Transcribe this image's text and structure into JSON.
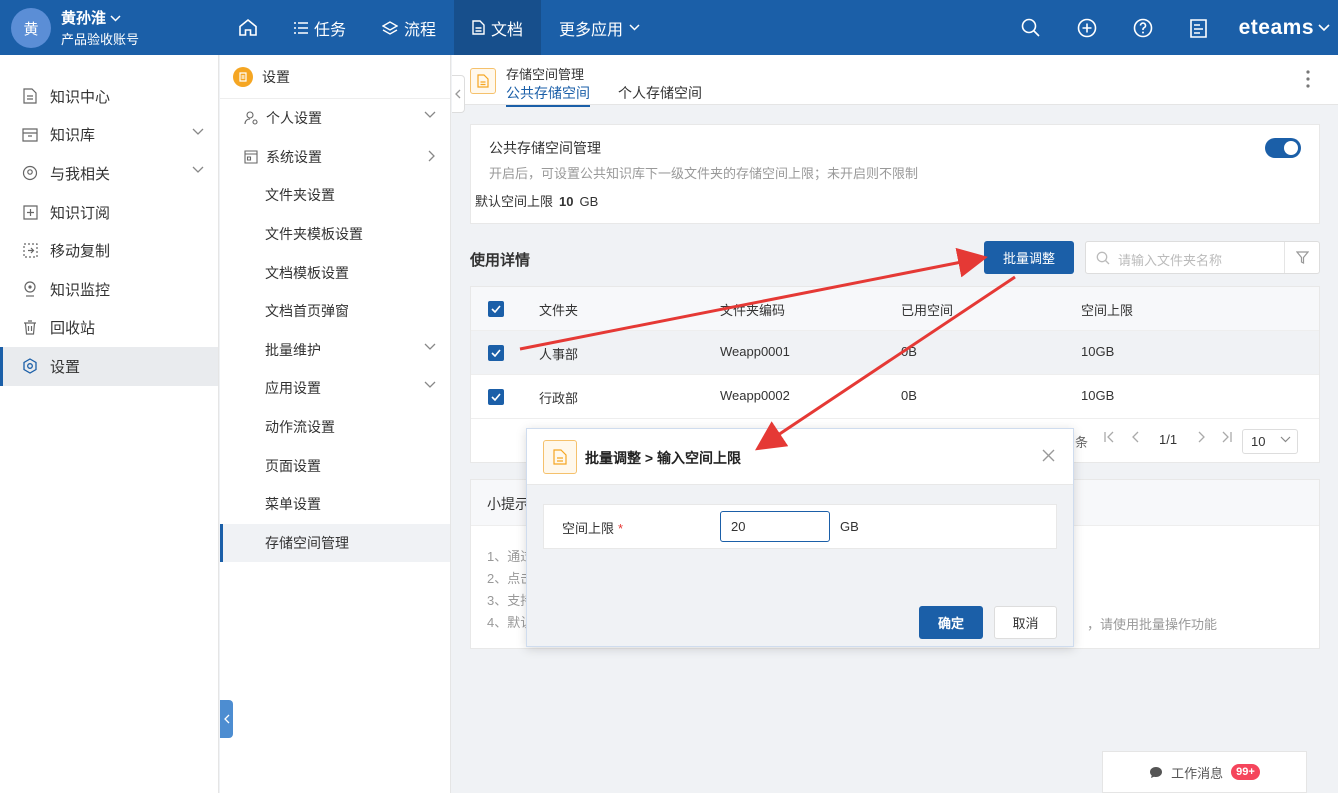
{
  "user": {
    "avatar": "黄",
    "name": "黄孙淮",
    "account": "产品验收账号"
  },
  "nav": {
    "tasks": "任务",
    "flow": "流程",
    "docs": "文档",
    "more": "更多应用",
    "brand": "eteams"
  },
  "sidebar": {
    "items": [
      {
        "label": "知识中心",
        "icon": "document-icon"
      },
      {
        "label": "知识库",
        "icon": "library-icon"
      },
      {
        "label": "与我相关",
        "icon": "user-related-icon"
      },
      {
        "label": "知识订阅",
        "icon": "subscribe-icon"
      },
      {
        "label": "移动复制",
        "icon": "move-copy-icon"
      },
      {
        "label": "知识监控",
        "icon": "monitor-icon"
      },
      {
        "label": "回收站",
        "icon": "trash-icon"
      },
      {
        "label": "设置",
        "icon": "settings-icon"
      }
    ]
  },
  "subside": {
    "title": "设置",
    "items": [
      "个人设置",
      "系统设置",
      "文件夹设置",
      "文件夹模板设置",
      "文档模板设置",
      "文档首页弹窗",
      "批量维护",
      "应用设置",
      "动作流设置",
      "页面设置",
      "菜单设置",
      "存储空间管理"
    ]
  },
  "page": {
    "title": "存储空间管理",
    "tabs": [
      "公共存储空间",
      "个人存储空间"
    ]
  },
  "card": {
    "title": "公共存储空间管理",
    "desc": "开启后，可设置公共知识库下一级文件夹的存储空间上限；未开启则不限制",
    "limit_label": "默认空间上限",
    "limit_value": "10",
    "limit_unit": "GB",
    "enabled": true
  },
  "usage": {
    "title": "使用详情",
    "batch_label": "批量调整",
    "search_placeholder": "请输入文件夹名称"
  },
  "table": {
    "headers": [
      "文件夹",
      "文件夹编码",
      "已用空间",
      "空间上限"
    ],
    "rows": [
      [
        "人事部",
        "Weapp0001",
        "0B",
        "10GB"
      ],
      [
        "行政部",
        "Weapp0002",
        "0B",
        "10GB"
      ]
    ],
    "pager_tail": "条",
    "page": "1/1",
    "page_size": "10"
  },
  "tips": {
    "title": "小提示",
    "lines": [
      "1、通过",
      "2、点击",
      "3、支持",
      "4、默认"
    ],
    "line4_tail": "，请使用批量操作功能"
  },
  "modal": {
    "title": "批量调整 > 输入空间上限",
    "label": "空间上限",
    "required_mark": "*",
    "value": "20",
    "unit": "GB",
    "ok": "确定",
    "cancel": "取消"
  },
  "messages": {
    "label": "工作消息",
    "badge": "99+"
  },
  "colors": {
    "primary": "#1b5fa8",
    "annotation_arrow": "#e53935",
    "badge": "#f5455c"
  }
}
